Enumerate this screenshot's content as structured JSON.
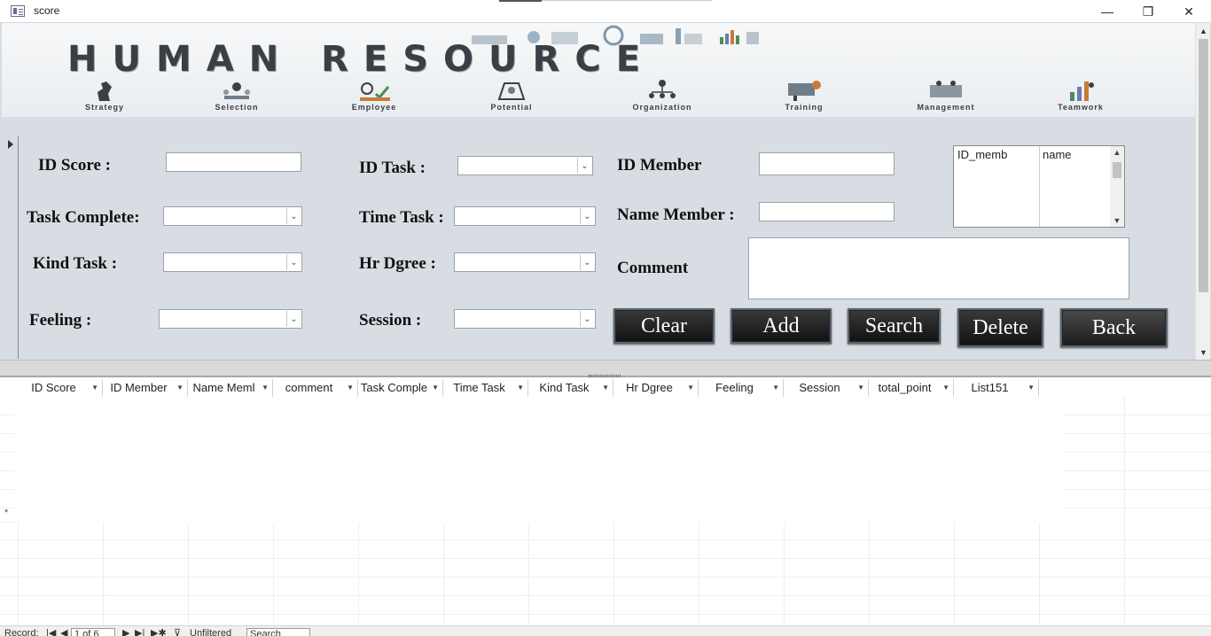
{
  "window": {
    "title": "score",
    "minimize_glyph": "—",
    "restore_glyph": "❐",
    "close_glyph": "✕"
  },
  "banner": {
    "title": "HUMAN RESOURCE",
    "items": [
      "Strategy",
      "Selection",
      "Employee",
      "Potential",
      "Organization",
      "Training",
      "Management",
      "Teamwork"
    ]
  },
  "form": {
    "id_score_label": "ID Score :",
    "task_complete_label": "Task Complete:",
    "kind_task_label": "Kind Task :",
    "feeling_label": "Feeling :",
    "id_task_label": "ID Task :",
    "time_task_label": "Time Task :",
    "hr_dgree_label": "Hr Dgree :",
    "session_label": "Session :",
    "id_member_label": "ID Member",
    "name_member_label": "Name Member :",
    "comment_label": "Comment",
    "dropdown_glyph": "⌄"
  },
  "member_list": {
    "columns": [
      "ID_memb",
      "name"
    ]
  },
  "buttons": {
    "clear": "Clear",
    "add": "Add",
    "search": "Search",
    "delete": "Delete",
    "back": "Back"
  },
  "datasheet": {
    "columns": [
      "ID Score",
      "ID Member",
      "Name Meml",
      "comment",
      "Task Comple",
      "Time Task",
      "Kind Task",
      "Hr Dgree",
      "Feeling",
      "Session",
      "total_point",
      "List151"
    ],
    "new_row_marker": "*"
  },
  "navigation": {
    "record_label": "Record:",
    "position": "1 of 6",
    "filter_status": "Unfiltered",
    "search_placeholder": "Search"
  },
  "colors": {
    "form_background": "#d7dde2",
    "button_background": "#1a1a1a",
    "button_text": "#ffffff"
  }
}
